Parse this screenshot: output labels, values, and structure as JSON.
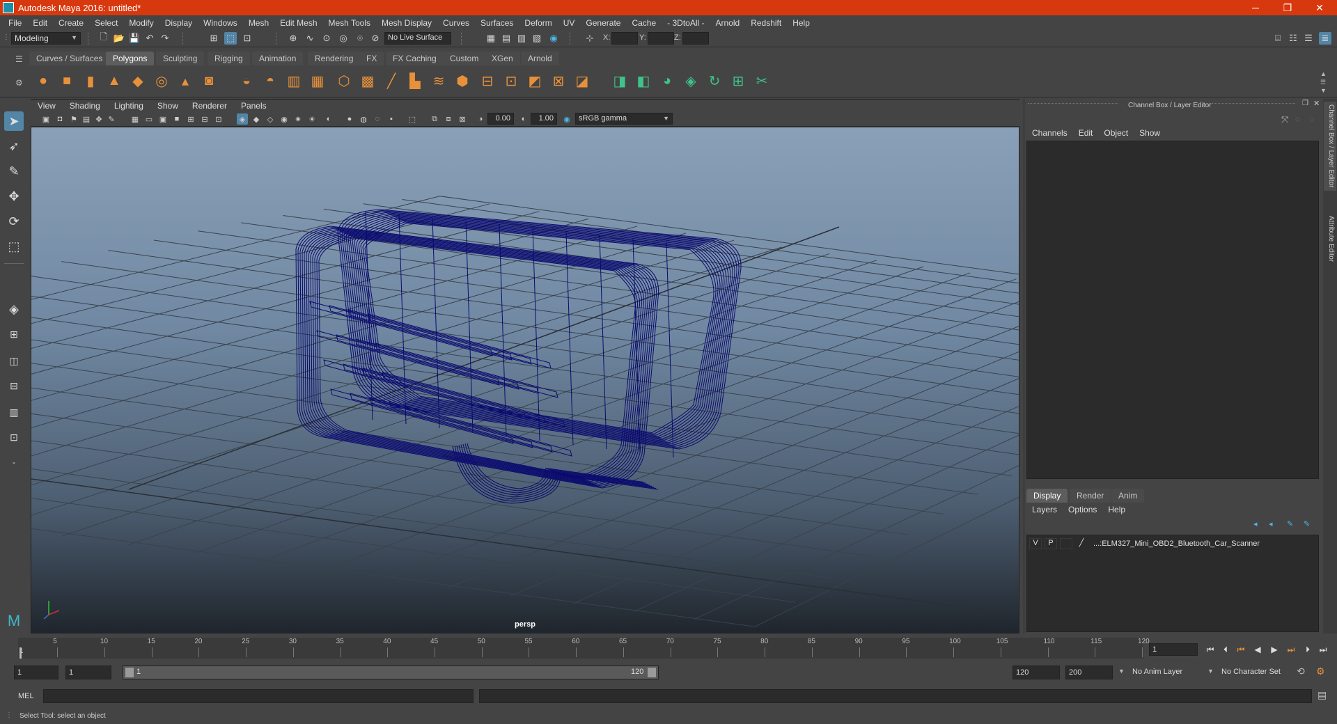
{
  "window": {
    "title": "Autodesk Maya 2016: untitled*",
    "minimize": "─",
    "maximize": "❐",
    "close": "✕"
  },
  "menubar": [
    "File",
    "Edit",
    "Create",
    "Select",
    "Modify",
    "Display",
    "Windows",
    "Mesh",
    "Edit Mesh",
    "Mesh Tools",
    "Mesh Display",
    "Curves",
    "Surfaces",
    "Deform",
    "UV",
    "Generate",
    "Cache",
    "- 3DtoAll -",
    "Arnold",
    "Redshift",
    "Help"
  ],
  "statusline": {
    "workspace": "Modeling",
    "live_surface": "No Live Surface",
    "x_label": "X:",
    "y_label": "Y:",
    "z_label": "Z:"
  },
  "shelf_tabs": [
    "Curves / Surfaces",
    "Polygons",
    "Sculpting",
    "Rigging",
    "Animation",
    "Rendering",
    "FX",
    "FX Caching",
    "Custom",
    "XGen",
    "Arnold"
  ],
  "shelf_active": "Polygons",
  "viewport": {
    "menu": [
      "View",
      "Shading",
      "Lighting",
      "Show",
      "Renderer",
      "Panels"
    ],
    "exposure": "0.00",
    "gamma": "1.00",
    "color_space": "sRGB gamma",
    "camera": "persp"
  },
  "right_panel": {
    "title": "Channel Box / Layer Editor",
    "menu": [
      "Channels",
      "Edit",
      "Object",
      "Show"
    ],
    "layer_tabs": [
      "Display",
      "Render",
      "Anim"
    ],
    "layer_menu": [
      "Layers",
      "Options",
      "Help"
    ],
    "layer": {
      "v": "V",
      "p": "P",
      "name": "...:ELM327_Mini_OBD2_Bluetooth_Car_Scanner"
    },
    "side_tabs": [
      "Channel Box / Layer Editor",
      "Attribute Editor"
    ]
  },
  "timeline": {
    "ticks": [
      "5",
      "10",
      "15",
      "20",
      "25",
      "30",
      "35",
      "40",
      "45",
      "50",
      "55",
      "60",
      "65",
      "70",
      "75",
      "80",
      "85",
      "90",
      "95",
      "100",
      "105",
      "110",
      "115",
      "120"
    ],
    "first": "1",
    "current_frame": "1"
  },
  "range": {
    "start": "1",
    "anim_start": "1",
    "slider_start": "1",
    "slider_end": "120",
    "end": "120",
    "anim_end": "200",
    "anim_layer": "No Anim Layer",
    "character_set": "No Character Set"
  },
  "cmdline": {
    "label": "MEL"
  },
  "help_line": "Select Tool: select an object",
  "colors": {
    "titlebar": "#d8380e",
    "wireframe": "#0a0a6e",
    "accent": "#5285a6"
  }
}
